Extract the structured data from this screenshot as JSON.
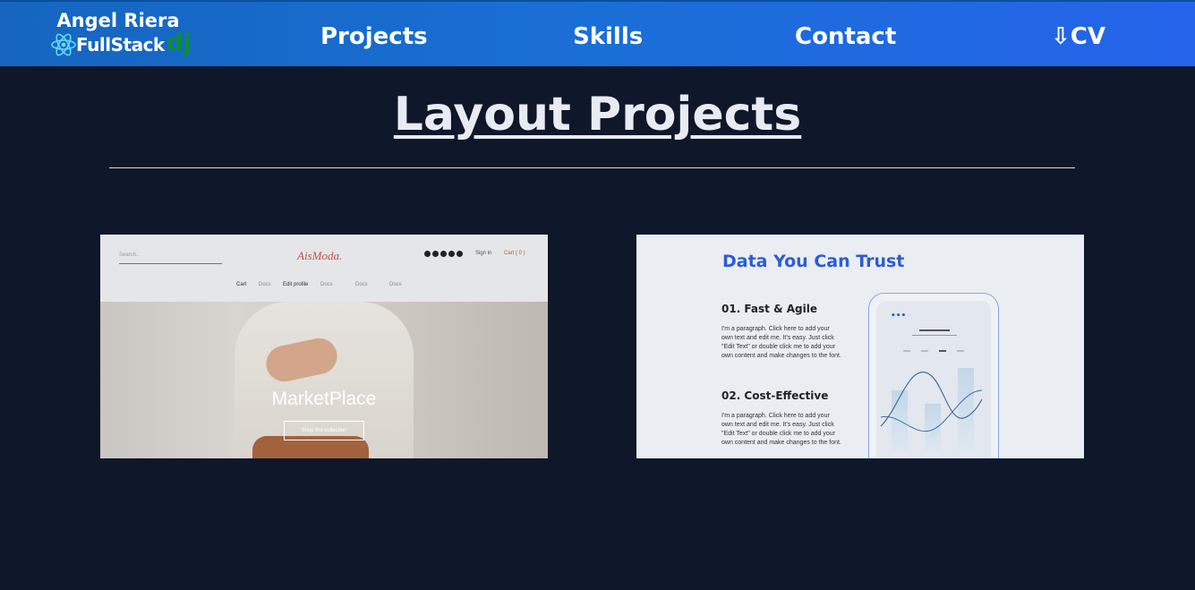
{
  "brand": {
    "name": "Angel Riera",
    "stack": "FullStack",
    "framework": "dj"
  },
  "nav": {
    "projects": "Projects",
    "skills": "Skills",
    "contact": "Contact",
    "cv": "⇩CV"
  },
  "page": {
    "title": "Layout Projects"
  },
  "projects": [
    {
      "site_logo": "AisModa.",
      "search_placeholder": "Search..",
      "sign_in": "Sign in",
      "cart_link": "Cart ( 0 )",
      "menu": [
        "Cart",
        "Docs",
        "Edit profile",
        "Docs",
        "Docs",
        "Docs"
      ],
      "hero_title": "MarketPlace",
      "hero_button": "Shop the collection"
    },
    {
      "title": "Data You Can Trust",
      "feature1_title": "01. Fast & Agile",
      "feature1_text": "I'm a paragraph. Click here to add your own text and edit me. It's easy. Just click \"Edit Text\" or double click me to add your own content and make changes to the font.",
      "feature2_title": "02. Cost-Effective",
      "feature2_text": "I'm a paragraph. Click here to add your own text and edit me. It's easy. Just click \"Edit Text\" or double click me to add your own content and make changes to the font.",
      "phone_menu": "•••"
    }
  ],
  "colors": {
    "nav_start": "#1565c0",
    "nav_end": "#2563eb",
    "background": "#0f172a",
    "accent": "#c0504d",
    "trust_blue": "#2d5bd3"
  }
}
